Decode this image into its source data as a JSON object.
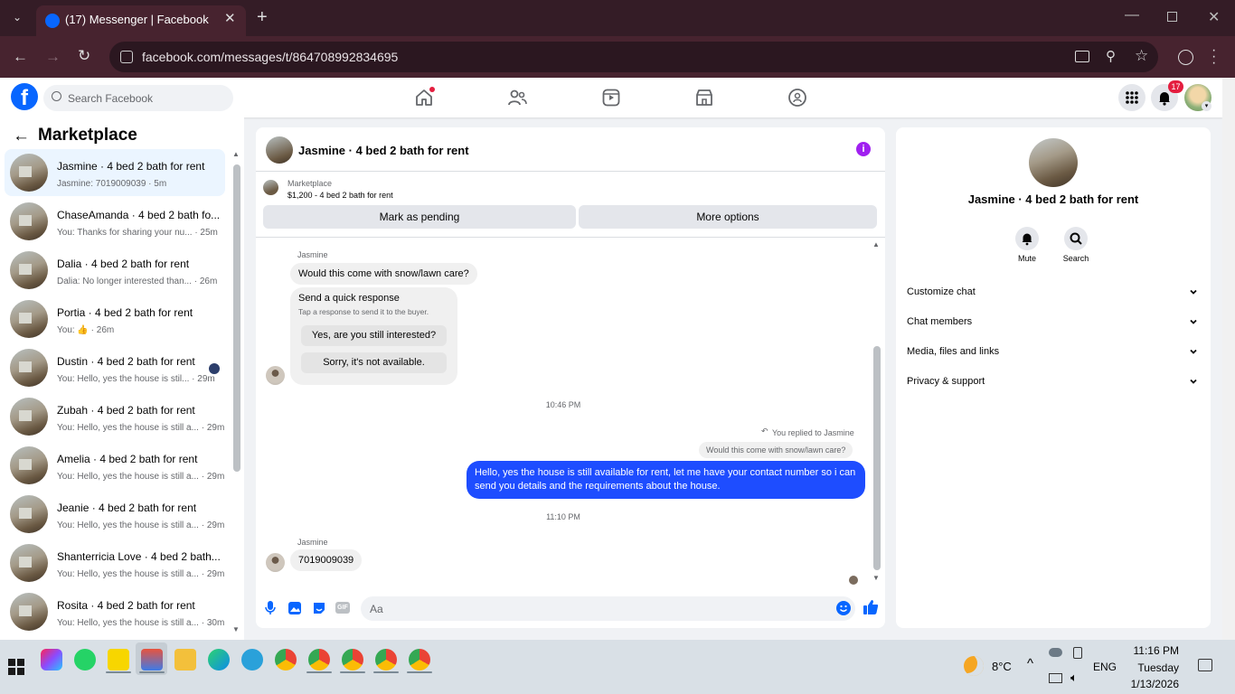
{
  "browser": {
    "tab_title": "(17) Messenger | Facebook",
    "url": "facebook.com/messages/t/864708992834695"
  },
  "fb": {
    "search_placeholder": "Search Facebook",
    "notifications_count": "17"
  },
  "sidebar": {
    "title": "Marketplace",
    "conversations": [
      {
        "name": "Jasmine · 4 bed 2 bath for rent",
        "preview": "Jasmine: 7019009039 · 5m"
      },
      {
        "name": "ChaseAmanda · 4 bed 2 bath fo...",
        "preview": "You: Thanks for sharing your nu... · 25m"
      },
      {
        "name": "Dalia · 4 bed 2 bath for rent",
        "preview": "Dalia: No longer interested than... · 26m"
      },
      {
        "name": "Portia · 4 bed 2 bath for rent",
        "preview": "You: 👍 · 26m"
      },
      {
        "name": "Dustin · 4 bed 2 bath for rent",
        "preview": "You: Hello, yes the house is stil... · 29m"
      },
      {
        "name": "Zubah · 4 bed 2 bath for rent",
        "preview": "You: Hello, yes the house is still a... · 29m"
      },
      {
        "name": "Amelia · 4 bed 2 bath for rent",
        "preview": "You: Hello, yes the house is still a... · 29m"
      },
      {
        "name": "Jeanie · 4 bed 2 bath for rent",
        "preview": "You: Hello, yes the house is still a... · 29m"
      },
      {
        "name": "Shanterricia Love · 4 bed 2 bath...",
        "preview": "You: Hello, yes the house is still a... · 29m"
      },
      {
        "name": "Rosita · 4 bed 2 bath for rent",
        "preview": "You: Hello, yes the house is still a... · 30m"
      }
    ]
  },
  "chat": {
    "title": "Jasmine · 4 bed 2 bath for rent",
    "listing_label": "Marketplace",
    "listing_detail": "$1,200 - 4 bed 2 bath for rent",
    "mark_pending": "Mark as pending",
    "more_options": "More options",
    "sender1": "Jasmine",
    "msg1": "Would this come with snow/lawn care?",
    "quick_title": "Send a quick response",
    "quick_sub": "Tap a response to send it to the buyer.",
    "quick_opt1": "Yes, are you still interested?",
    "quick_opt2": "Sorry, it's not available.",
    "time1": "10:46 PM",
    "replied_label": "You replied to Jasmine",
    "replied_quote": "Would this come with snow/lawn care?",
    "my_msg": "Hello, yes the house is still available for rent, let me have your contact number so i can send you details and the requirements about the house.",
    "time2": "11:10 PM",
    "sender2": "Jasmine",
    "msg2": "7019009039",
    "composer_placeholder": "Aa"
  },
  "info": {
    "name": "Jasmine · 4 bed 2 bath for rent",
    "mute": "Mute",
    "search": "Search",
    "sections": [
      "Customize chat",
      "Chat members",
      "Media, files and links",
      "Privacy & support"
    ]
  },
  "taskbar": {
    "weather": "8°C",
    "lang": "ENG",
    "time": "11:16 PM",
    "day": "Tuesday",
    "date": "1/13/2026"
  },
  "colors": {
    "fb_blue": "#0866ff",
    "bubble_mine": "#1e4dff",
    "accent_purple": "#a020f0"
  }
}
